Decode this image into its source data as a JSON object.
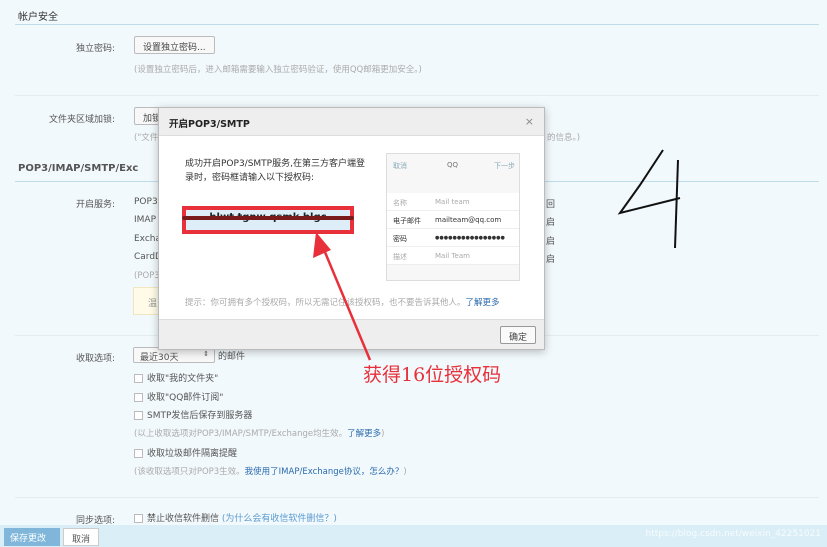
{
  "account_security": {
    "title": "帐户安全",
    "independent_password_label": "独立密码:",
    "set_password_button": "设置独立密码...",
    "password_hint": "(设置独立密码后，进入邮箱需要输入独立密码验证，使用QQ邮箱更加安全。)",
    "folder_lock_label": "文件夹区域加锁:",
    "folder_lock_button": "加锁",
    "folder_lock_hint_start": "(\"文件",
    "folder_lock_hint_end": "的信息。)"
  },
  "pop3": {
    "title": "POP3/IMAP/SMTP/Exc",
    "service_label": "开启服务:",
    "services": [
      "POP3",
      "IMAP",
      "Excha",
      "CardD"
    ],
    "hint": "(POP3",
    "notice": "温",
    "link_fragments": [
      "回",
      "启",
      "启",
      "启"
    ]
  },
  "dialog": {
    "title": "开启POP3/SMTP",
    "close": "×",
    "message": "成功开启POP3/SMTP服务,在第三方客户端登录时，密码框请输入以下授权码:",
    "auth_code": "hlwt tgnw qsmk blgc",
    "tip": "提示：你可拥有多个授权码，所以无需记住该授权码，也不要告诉其他人。",
    "learn_more": "了解更多",
    "ok_button": "确定",
    "phone": {
      "cancel": "取消",
      "title": "QQ",
      "next": "下一步",
      "rows": [
        {
          "k": "名称",
          "v": "Mail team"
        },
        {
          "k": "电子邮件",
          "v": "mailteam@qq.com"
        },
        {
          "k": "密码",
          "v": "●●●●●●●●●●●●●●●●"
        },
        {
          "k": "描述",
          "v": "Mail Team"
        }
      ]
    }
  },
  "annotation": {
    "text": "获得16位授权码",
    "handwritten": "4",
    "color": "#e8303a"
  },
  "receive": {
    "label": "收取选项:",
    "select_value": "最近30天",
    "select_suffix": "的邮件",
    "options": [
      "收取\"我的文件夹\"",
      "收取\"QQ邮件订阅\"",
      "SMTP发信后保存到服务器"
    ],
    "hint1": "(以上收取选项对POP3/IMAP/SMTP/Exchange均生效。",
    "hint1_link": "了解更多",
    "hint1_end": ")",
    "spam_option": "收取垃圾邮件隔离提醒",
    "hint2": "(该收取选项只对POP3生效。",
    "hint2_link": "我使用了IMAP/Exchange协议，怎么办？",
    "hint2_end": ")"
  },
  "sync": {
    "label": "同步选项:",
    "option": "禁止收信软件删信",
    "link": "(为什么会有收信软件删信？)"
  },
  "footer": {
    "save": "保存更改",
    "cancel": "取消",
    "watermark": "https://blog.csdn.net/weixin_42251021"
  }
}
